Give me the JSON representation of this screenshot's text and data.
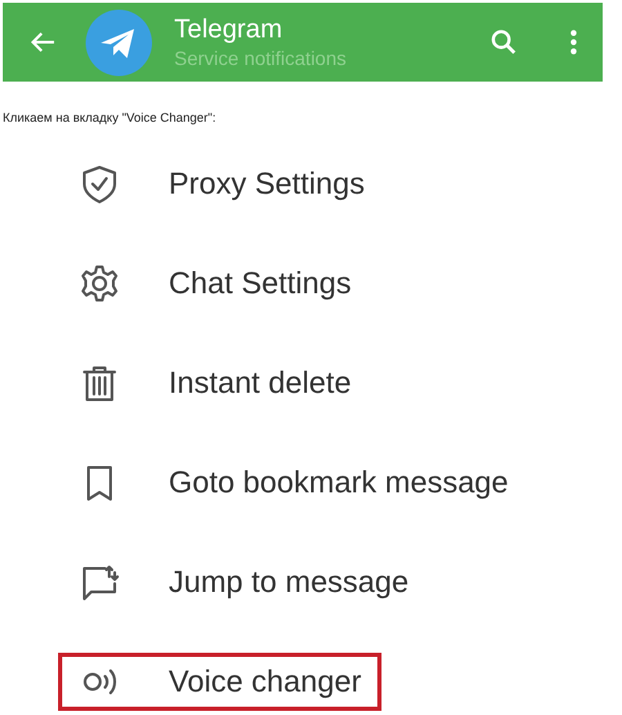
{
  "header": {
    "title": "Telegram",
    "subtitle": "Service notifications"
  },
  "caption": "Кликаем на вкладку \"Voice Changer\":",
  "menu": [
    {
      "kind": "shield",
      "label": "Proxy Settings",
      "highlighted": false
    },
    {
      "kind": "gear",
      "label": "Chat Settings",
      "highlighted": false
    },
    {
      "kind": "trash",
      "label": "Instant delete",
      "highlighted": false
    },
    {
      "kind": "bookmark",
      "label": "Goto bookmark message",
      "highlighted": false
    },
    {
      "kind": "jump",
      "label": "Jump to message",
      "highlighted": false
    },
    {
      "kind": "voice",
      "label": "Voice changer",
      "highlighted": true
    }
  ]
}
